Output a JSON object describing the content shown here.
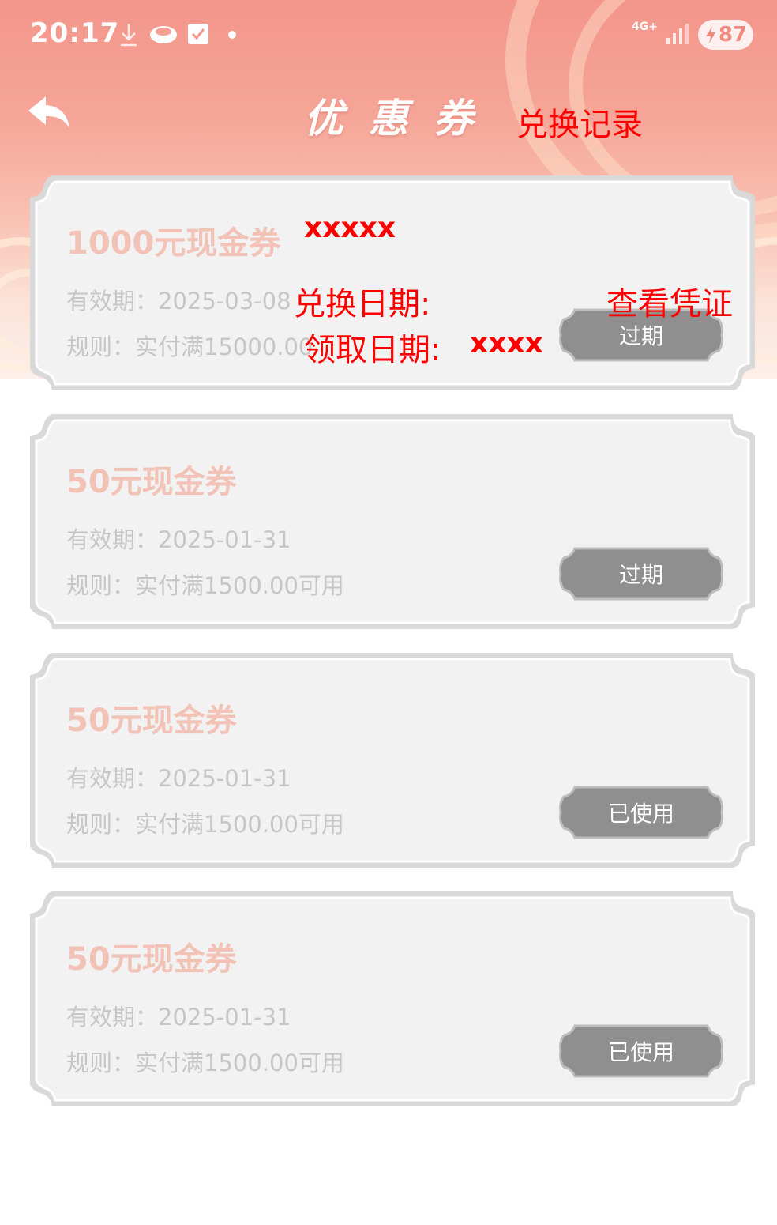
{
  "status_bar": {
    "time": "20:17",
    "network": "4G+",
    "battery": "87",
    "icons": [
      "download-icon",
      "cloud-icon",
      "checkbox-icon",
      "dot-icon",
      "signal-icon",
      "charging-icon"
    ]
  },
  "header": {
    "title": "优惠券",
    "back_icon": "back-arrow-icon",
    "exchange_record": "兑换记录"
  },
  "coupons": [
    {
      "title": "1000元现金券",
      "validity": "有效期：2025-03-08",
      "rule": "规则：实付满15000.00",
      "status": "过期"
    },
    {
      "title": "50元现金券",
      "validity": "有效期：2025-01-31",
      "rule": "规则：实付满1500.00可用",
      "status": "过期"
    },
    {
      "title": "50元现金券",
      "validity": "有效期：2025-01-31",
      "rule": "规则：实付满1500.00可用",
      "status": "已使用"
    },
    {
      "title": "50元现金券",
      "validity": "有效期：2025-01-31",
      "rule": "规则：实付满1500.00可用",
      "status": "已使用"
    }
  ],
  "annotations": {
    "name_placeholder": "xxxxx",
    "exchange_date": "兑换日期:",
    "view_voucher": "查看凭证",
    "receive_date": "领取日期:",
    "receive_date_value": "xxxx"
  },
  "colors": {
    "header_top": "#f3958b",
    "coupon_title": "#f2c2b6",
    "status_button": "#8f8f8f",
    "annotation": "#ff0000"
  }
}
